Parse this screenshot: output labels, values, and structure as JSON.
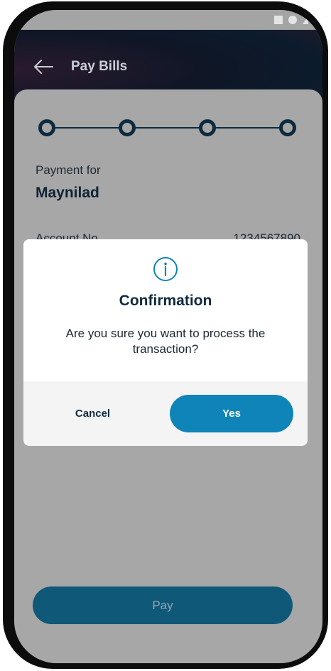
{
  "header": {
    "title": "Pay Bills",
    "back_icon": "arrow-left-icon"
  },
  "stepper": {
    "steps": 4
  },
  "payment": {
    "payment_for_label": "Payment for",
    "biller_name": "Maynilad",
    "account_label": "Account No.",
    "account_value": "1234567890"
  },
  "footer": {
    "pay_label": "Pay"
  },
  "dialog": {
    "icon": "info-icon",
    "title": "Confirmation",
    "message": "Are you sure you want to process the transaction?",
    "cancel_label": "Cancel",
    "confirm_label": "Yes"
  },
  "colors": {
    "primary": "#0f84b8",
    "dark_navy": "#0f2a3e",
    "overlay": "#a7a7a7"
  }
}
